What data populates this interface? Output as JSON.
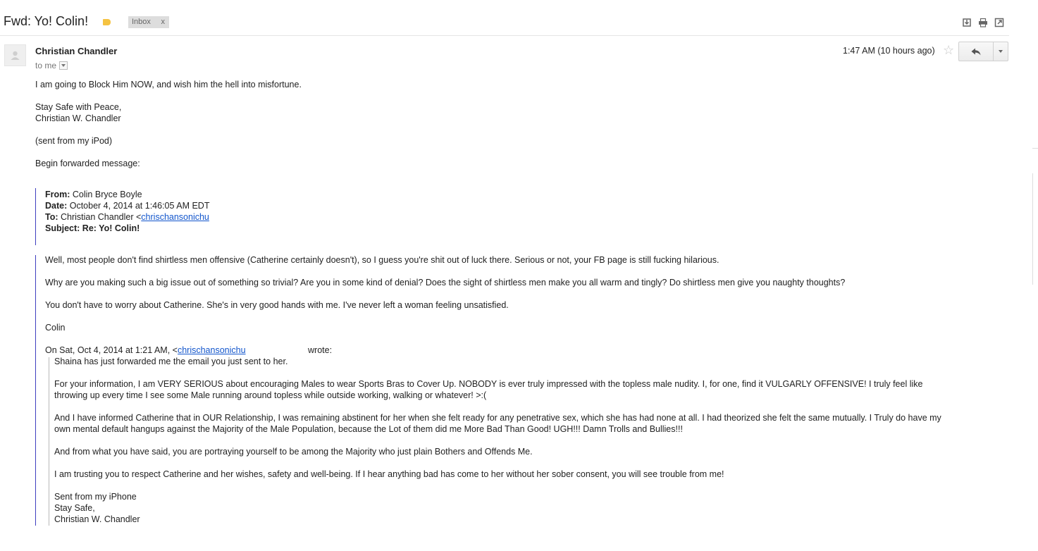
{
  "header": {
    "subject": "Fwd: Yo! Colin!",
    "label_icon": "label-tag-icon",
    "label_chip": "Inbox",
    "label_chip_close": "x",
    "tools": [
      "download-icon",
      "print-icon",
      "new-window-icon"
    ]
  },
  "message": {
    "sender": "Christian Chandler",
    "to_line": "to me",
    "timestamp": "1:47 AM (10 hours ago)",
    "star_icon": "star-icon",
    "reply_icon": "reply-icon",
    "more_icon": "dropdown-arrow-icon",
    "body_lines": [
      "I am going to Block Him NOW, and wish him the hell into misfortune.",
      "Stay Safe with Peace,",
      "Christian W. Chandler",
      "(sent from my iPod)",
      "Begin forwarded message:"
    ],
    "fwd_header": {
      "from_label": "From:",
      "from_value": " Colin Bryce Boyle",
      "date_label": "Date:",
      "date_value": " October 4, 2014 at 1:46:05 AM EDT",
      "to_label": "To:",
      "to_value": " Christian Chandler <",
      "to_link": "chrischansonichu",
      "subject_label": "Subject:",
      "subject_value": " Re: Yo! Colin!"
    },
    "reply": {
      "paragraphs": [
        "Well, most people don't find shirtless men offensive (Catherine certainly doesn't), so I guess you're shit out of luck there. Serious or not, your FB page is still fucking hilarious.",
        "Why are you making such a big issue out of something so trivial? Are you in some kind of denial? Does the sight of shirtless men make you all warm and tingly? Do shirtless men give you naughty thoughts?",
        "You don't have to worry about Catherine. She's in very good hands with me. I've never left a woman feeling unsatisfied.",
        "Colin"
      ],
      "attribution_prefix": "On Sat, Oct 4, 2014 at 1:21 AM, <",
      "attribution_link": "chrischansonichu",
      "attribution_suffix": "wrote:"
    },
    "quoted": [
      "Shaina has just forwarded me the email you just sent to her.",
      "For your information, I am VERY SERIOUS about encouraging Males to wear Sports Bras to Cover Up.  NOBODY is ever truly impressed with the topless male nudity.  I, for one, find it VULGARLY OFFENSIVE!  I truly feel like",
      "throwing up every time I see some Male running around topless while outside working, walking or whatever!  >:(",
      "And I have informed Catherine that in OUR Relationship, I was remaining abstinent for her when she felt ready for any penetrative sex, which she has had none at all.  I had theorized she felt the same mutually.  I Truly do have my",
      "own mental default hangups against the Majority of the Male Population, because the Lot of them did me More Bad Than Good!  UGH!!!   Damn Trolls and Bullies!!!",
      "And from what you have said, you are portraying yourself to be among the Majority who just plain Bothers and Offends Me.",
      "I am trusting you to respect Catherine and her wishes, safety and well-being.  If I hear anything bad has come to her without her sober consent, you will see trouble from me!",
      "Sent from my iPhone",
      "Stay Safe,",
      "Christian W. Chandler"
    ]
  }
}
